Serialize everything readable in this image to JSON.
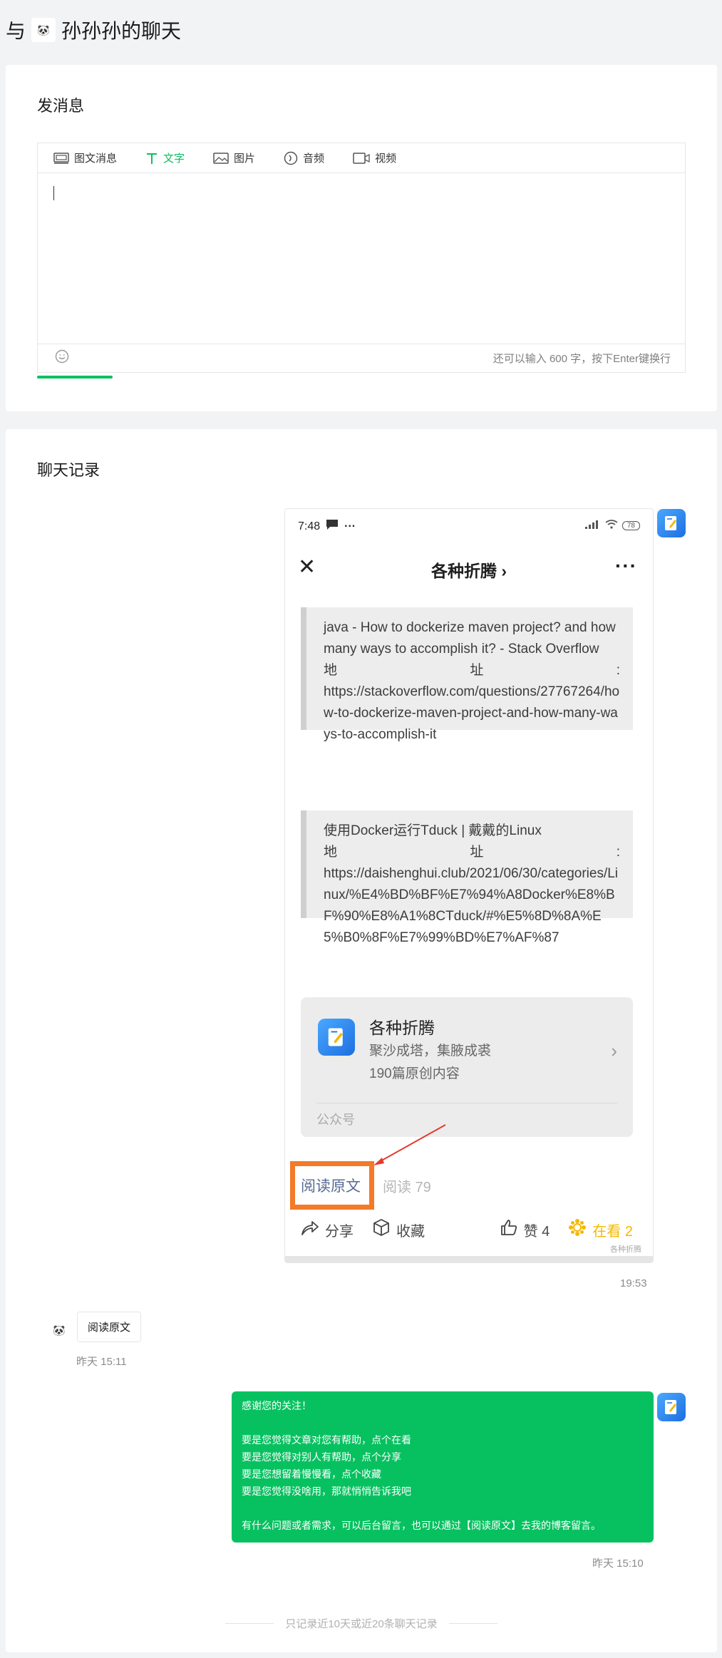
{
  "header": {
    "prefix": "与",
    "contact_name": "孙孙孙的聊天"
  },
  "compose": {
    "title": "发消息",
    "tabs": [
      {
        "label": "图文消息",
        "icon": "article-icon"
      },
      {
        "label": "文字",
        "icon": "text-icon",
        "active": true
      },
      {
        "label": "图片",
        "icon": "image-icon"
      },
      {
        "label": "音频",
        "icon": "audio-icon"
      },
      {
        "label": "视频",
        "icon": "video-icon"
      }
    ],
    "input_value": "",
    "counter": "还可以输入 600 字，按下Enter键换行"
  },
  "history": {
    "title": "聊天记录",
    "screenshot": {
      "status_time": "7:48",
      "status_signal": "all",
      "battery": "78",
      "nav_title": "各种折腾 ›",
      "quote1": {
        "line1": "java - How to dockerize maven project? and how many ways to accomplish it? - Stack Overflow",
        "addr_label_a": "地",
        "addr_label_b": "址",
        "addr_label_c": ":",
        "url": "https://stackoverflow.com/questions/27767264/how-to-dockerize-maven-project-and-how-many-ways-to-accomplish-it"
      },
      "quote2": {
        "line1": "使用Docker运行Tduck | 戴戴的Linux",
        "addr_label_a": "地",
        "addr_label_b": "址",
        "addr_label_c": ":",
        "url": "https://daishenghui.club/2021/06/30/categories/Linux/%E4%BD%BF%E7%94%A8Docker%E8%BF%90%E8%A1%8CTduck/#%E5%8D%8A%E5%B0%8F%E7%99%BD%E7%AF%87"
      },
      "profile": {
        "name": "各种折腾",
        "desc": "聚沙成塔，集腋成裘",
        "count": "190篇原创内容",
        "label": "公众号"
      },
      "read_original": "阅读原文",
      "read_count": "阅读 79",
      "actions": {
        "share": "分享",
        "favorite": "收藏",
        "like": "赞 4",
        "wow": "在看 2"
      },
      "watermark": "各种折腾"
    },
    "screenshot_time": "19:53",
    "user_message": {
      "text": "阅读原文",
      "time": "昨天 15:11"
    },
    "bot_message": {
      "text": "感谢您的关注！\n\n要是您觉得文章对您有帮助，点个在看\n要是您觉得对别人有帮助，点个分享\n要是您想留着慢慢看，点个收藏\n要是您觉得没啥用，那就悄悄告诉我吧\n\n有什么问题或者需求，可以后台留言，也可以通过【阅读原文】去我的博客留言。",
      "time": "昨天 15:10"
    },
    "footer_note": "只记录近10天或近20条聊天记录"
  },
  "colors": {
    "accent": "#07c160",
    "annotation": "#f27a29",
    "link": "#576b95"
  }
}
